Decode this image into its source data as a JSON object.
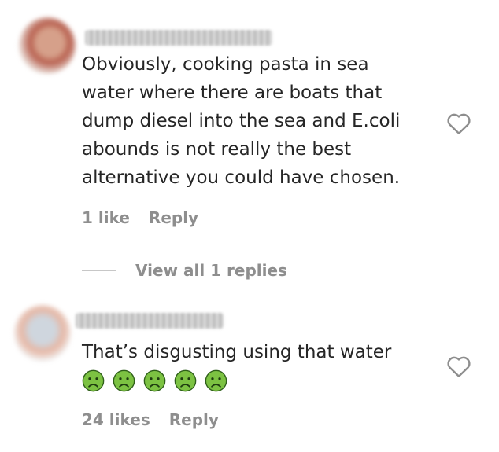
{
  "comments": [
    {
      "text_lines": [
        "Obviously, cooking pasta in sea",
        "water where there are boats that",
        "dump diesel into the sea and E.coli",
        "abounds is not really the best",
        "alternative you could have chosen."
      ],
      "likes": "1 like",
      "reply_label": "Reply",
      "view_replies": "View all 1 replies"
    },
    {
      "text_lines": [
        "That’s disgusting using that water"
      ],
      "emoji": [
        "nauseated-face",
        "nauseated-face",
        "nauseated-face",
        "nauseated-face",
        "nauseated-face"
      ],
      "likes": "24 likes",
      "reply_label": "Reply"
    }
  ],
  "colors": {
    "text": "#262626",
    "meta": "#8e8e8e",
    "emoji_green": "#7cc242",
    "heart_outline": "#8e8e8e"
  }
}
